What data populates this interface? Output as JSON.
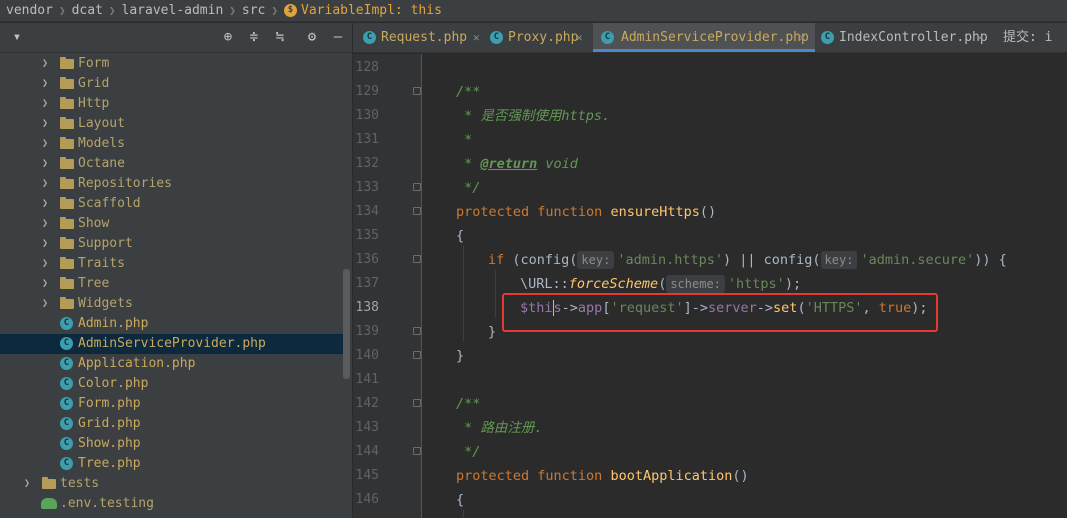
{
  "breadcrumb": {
    "items": [
      "vendor",
      "dcat",
      "laravel-admin",
      "src"
    ],
    "last_icon": "$",
    "last": "VariableImpl: this"
  },
  "project_panel": {
    "toolbar_icons": [
      "dropdown-icon",
      "locate-icon",
      "expand-all-icon",
      "collapse-all-icon",
      "gear-icon",
      "minimize-icon"
    ],
    "tree": [
      {
        "label": "Form",
        "kind": "folder"
      },
      {
        "label": "Grid",
        "kind": "folder"
      },
      {
        "label": "Http",
        "kind": "folder"
      },
      {
        "label": "Layout",
        "kind": "folder"
      },
      {
        "label": "Models",
        "kind": "folder"
      },
      {
        "label": "Octane",
        "kind": "folder"
      },
      {
        "label": "Repositories",
        "kind": "folder"
      },
      {
        "label": "Scaffold",
        "kind": "folder"
      },
      {
        "label": "Show",
        "kind": "folder"
      },
      {
        "label": "Support",
        "kind": "folder"
      },
      {
        "label": "Traits",
        "kind": "folder"
      },
      {
        "label": "Tree",
        "kind": "folder"
      },
      {
        "label": "Widgets",
        "kind": "folder"
      },
      {
        "label": "Admin.php",
        "kind": "file"
      },
      {
        "label": "AdminServiceProvider.php",
        "kind": "file",
        "selected": true
      },
      {
        "label": "Application.php",
        "kind": "file"
      },
      {
        "label": "Color.php",
        "kind": "file"
      },
      {
        "label": "Form.php",
        "kind": "file"
      },
      {
        "label": "Grid.php",
        "kind": "file"
      },
      {
        "label": "Show.php",
        "kind": "file"
      },
      {
        "label": "Tree.php",
        "kind": "file"
      },
      {
        "label": "tests",
        "kind": "folder-root"
      },
      {
        "label": ".env.testing",
        "kind": "env"
      }
    ]
  },
  "tabs": [
    {
      "label": "Request.php",
      "active": false
    },
    {
      "label": "Proxy.php",
      "active": false
    },
    {
      "label": "AdminServiceProvider.php",
      "active": true
    },
    {
      "label": "IndexController.php",
      "active": false
    }
  ],
  "tab_overflow_label": "提交: i",
  "editor": {
    "line_numbers": [
      "128",
      "129",
      "130",
      "131",
      "132",
      "133",
      "134",
      "135",
      "136",
      "137",
      "138",
      "139",
      "140",
      "141",
      "142",
      "143",
      "144",
      "145",
      "146"
    ],
    "current_line": "138",
    "code": {
      "l129": "/**",
      "l130": " * 是否强制使用https.",
      "l131": " *",
      "l132_star": " * ",
      "l132_tag": "@return",
      "l132_rest": " void",
      "l133": " */",
      "l134_kw": "protected function ",
      "l134_fn": "ensureHttps",
      "l134_rest": "()",
      "l135": "{",
      "l136_kw": "if",
      "l136_a": " (config(",
      "l136_hint1": "key:",
      "l136_s1": "'admin.https'",
      "l136_b": ") || config(",
      "l136_hint2": "key:",
      "l136_s2": "'admin.secure'",
      "l136_c": ")) {",
      "l137_a": "\\URL::",
      "l137_fn": "forceScheme",
      "l137_b": "(",
      "l137_hint": "scheme:",
      "l137_s": "'https'",
      "l137_c": ");",
      "l138_var1": "$thi",
      "l138_var2": "s",
      "l138_a": "->",
      "l138_p1": "app",
      "l138_b": "[",
      "l138_s1": "'request'",
      "l138_c": "]->",
      "l138_p2": "server",
      "l138_d": "->",
      "l138_fn": "set",
      "l138_e": "(",
      "l138_s2": "'HTTPS'",
      "l138_f": ", ",
      "l138_kw": "true",
      "l138_g": ");",
      "l139": "}",
      "l140": "}",
      "l142": "/**",
      "l143": " * 路由注册.",
      "l144": " */",
      "l145_kw": "protected function ",
      "l145_fn": "bootApplication",
      "l145_rest": "()",
      "l146": "{"
    }
  }
}
